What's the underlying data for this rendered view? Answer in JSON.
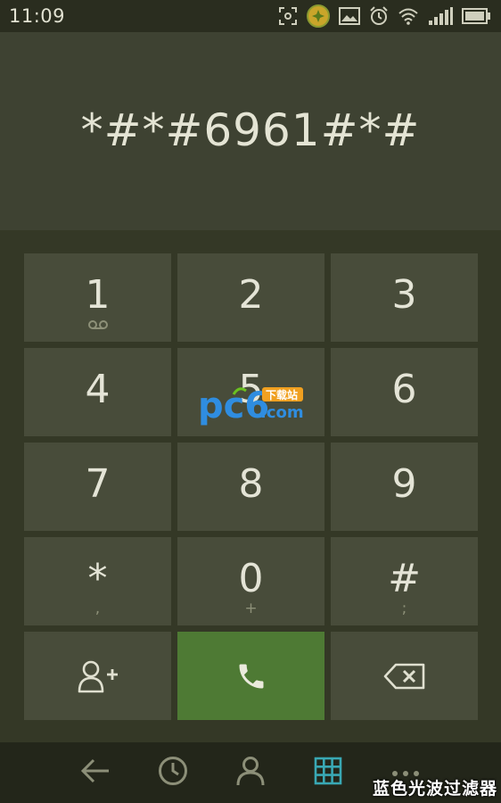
{
  "status_bar": {
    "time": "11:09"
  },
  "display": {
    "dialed_number": "*#*#6961#*#"
  },
  "keypad": {
    "keys": [
      {
        "digit": "1",
        "sub": "ꝏ"
      },
      {
        "digit": "2",
        "sub": ""
      },
      {
        "digit": "3",
        "sub": ""
      },
      {
        "digit": "4",
        "sub": ""
      },
      {
        "digit": "5",
        "sub": ""
      },
      {
        "digit": "6",
        "sub": ""
      },
      {
        "digit": "7",
        "sub": ""
      },
      {
        "digit": "8",
        "sub": ""
      },
      {
        "digit": "9",
        "sub": ""
      },
      {
        "digit": "*",
        "sub": ","
      },
      {
        "digit": "0",
        "sub": "+"
      },
      {
        "digit": "#",
        "sub": ";"
      }
    ]
  },
  "watermark": {
    "brand_main": "pc6",
    "brand_suffix": ".com",
    "brand_tag": "下载站"
  },
  "bottom_nav": {
    "items": [
      "back-icon",
      "clock-icon",
      "person-icon",
      "dialpad-icon",
      "more-icon"
    ]
  },
  "caption": "蓝色光波过滤器",
  "colors": {
    "accent_call": "#4e7a34",
    "dialpad_active": "#39a8b4"
  }
}
